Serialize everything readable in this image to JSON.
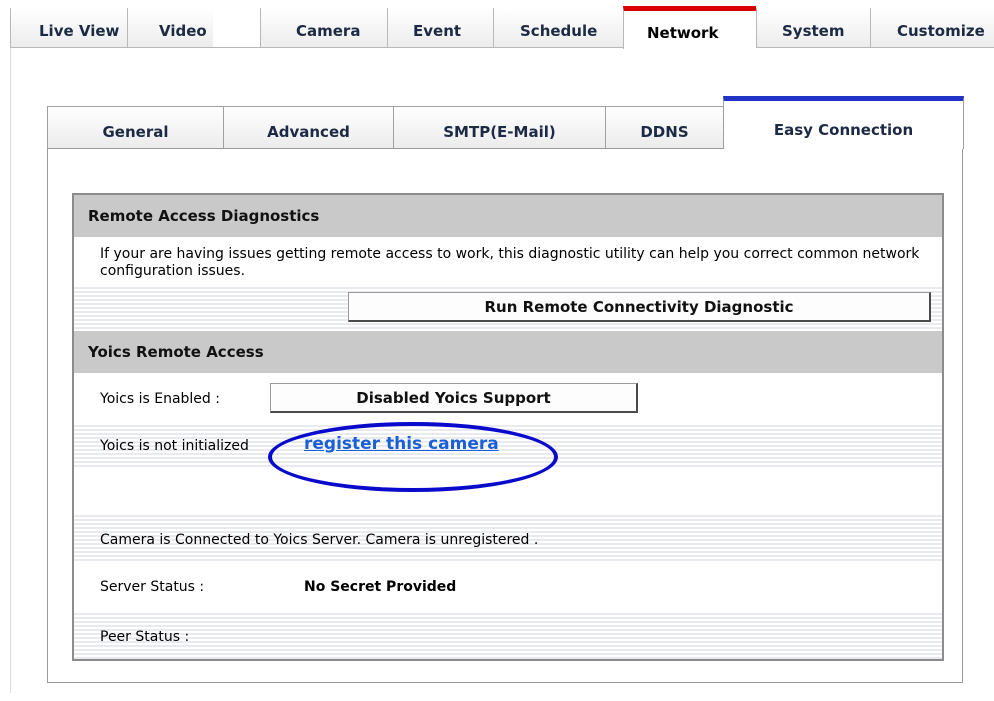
{
  "top_nav": {
    "tabs": [
      {
        "label": "Live View"
      },
      {
        "label": "Video"
      },
      {
        "label": "Camera"
      },
      {
        "label": "Event"
      },
      {
        "label": "Schedule"
      },
      {
        "label": "Network",
        "active": true
      },
      {
        "label": "System"
      },
      {
        "label": "Customize"
      }
    ]
  },
  "sub_nav": {
    "tabs": [
      {
        "label": "General"
      },
      {
        "label": "Advanced"
      },
      {
        "label": "SMTP(E-Mail)"
      },
      {
        "label": "DDNS"
      },
      {
        "label": "Easy Connection",
        "active": true
      }
    ]
  },
  "diagnostics": {
    "title": "Remote Access Diagnostics",
    "description": "If your are having issues getting remote access to work, this diagnostic utility can help you correct common network configuration issues.",
    "run_button": "Run Remote Connectivity Diagnostic"
  },
  "yoics": {
    "title": "Yoics Remote Access",
    "enabled_label": "Yoics is Enabled :",
    "toggle_button": "Disabled Yoics Support",
    "init_text": "Yoics is not initialized",
    "register_link": "register this camera",
    "connection_text": "Camera is Connected to Yoics Server. Camera is unregistered .",
    "server_status_label": "Server Status :",
    "server_status_value": "No Secret Provided",
    "peer_status_label": "Peer Status :",
    "peer_status_value": ""
  },
  "colors": {
    "active_top_tab_accent": "#d80000",
    "active_sub_tab_accent": "#2233c8",
    "link": "#1a5fd6",
    "annotation_circle": "#0a0acc",
    "section_header_bg": "#c9c9c9"
  }
}
